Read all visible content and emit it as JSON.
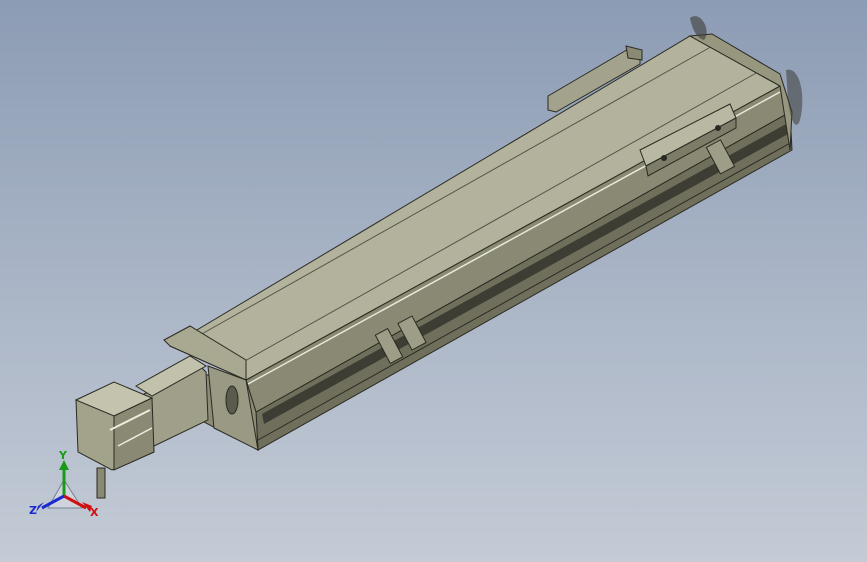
{
  "view": {
    "background_top": "#8c9cb4",
    "background_bottom": "#c4cbd6",
    "model_color": "#a9a890"
  },
  "triad": {
    "x_label": "X",
    "y_label": "Y",
    "z_label": "Z",
    "x_color": "#d01010",
    "y_color": "#1a9a1a",
    "z_color": "#1a2ad0"
  }
}
